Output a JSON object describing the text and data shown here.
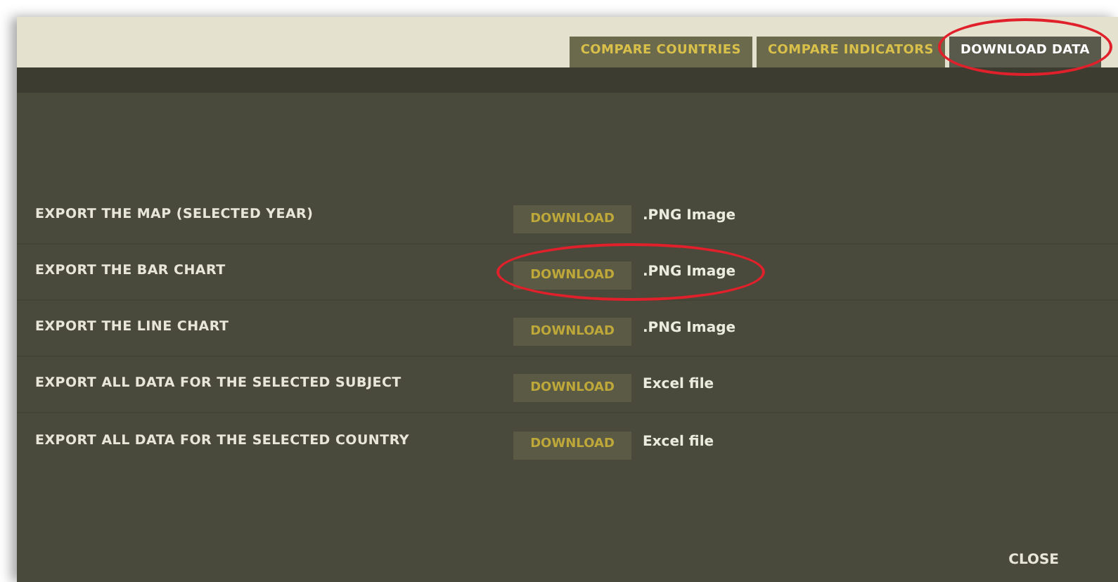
{
  "tabs": [
    {
      "label": "COMPARE COUNTRIES",
      "selected": false,
      "circled": false
    },
    {
      "label": "COMPARE INDICATORS",
      "selected": false,
      "circled": false
    },
    {
      "label": "DOWNLOAD DATA",
      "selected": true,
      "circled": true
    }
  ],
  "exports": [
    {
      "label": "EXPORT THE MAP (SELECTED YEAR)",
      "button": "DOWNLOAD",
      "format": ".PNG Image",
      "circled": false
    },
    {
      "label": "EXPORT THE BAR CHART",
      "button": "DOWNLOAD",
      "format": ".PNG Image",
      "circled": true
    },
    {
      "label": "EXPORT THE LINE CHART",
      "button": "DOWNLOAD",
      "format": ".PNG Image",
      "circled": false
    },
    {
      "label": "EXPORT ALL DATA FOR THE SELECTED SUBJECT",
      "button": "DOWNLOAD",
      "format": "Excel file",
      "circled": false
    },
    {
      "label": "EXPORT ALL DATA FOR THE SELECTED COUNTRY",
      "button": "DOWNLOAD",
      "format": "Excel file",
      "circled": false
    }
  ],
  "close": "CLOSE"
}
